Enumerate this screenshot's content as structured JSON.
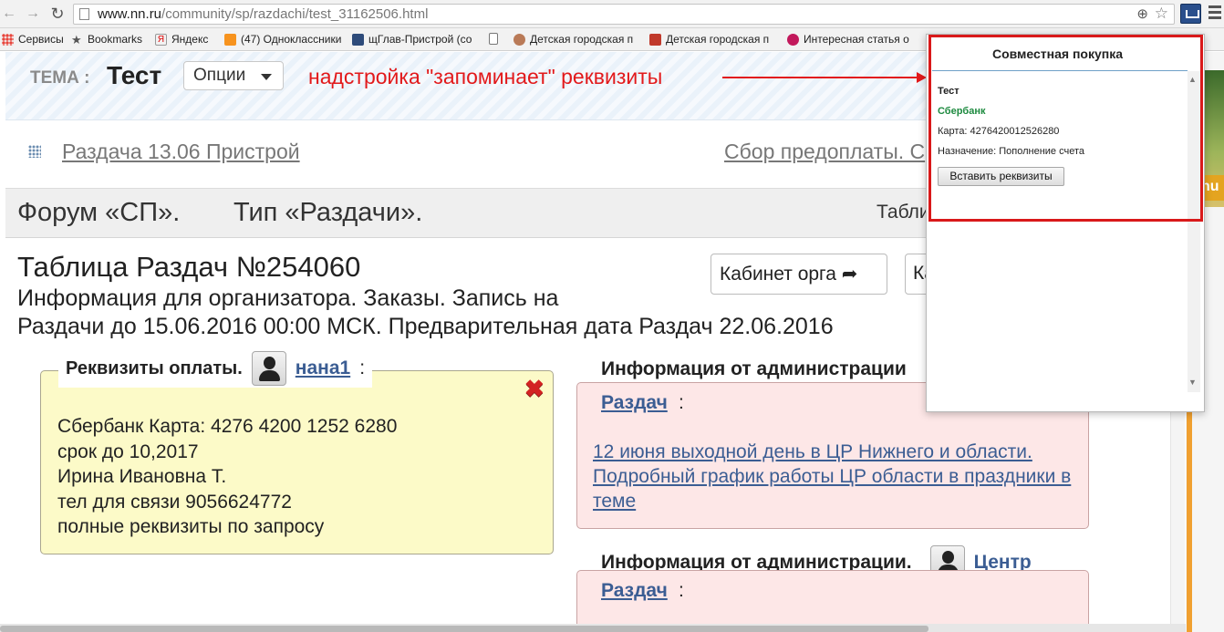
{
  "browser": {
    "url_host": "www.nn.ru",
    "url_path": "/community/sp/razdachi/test_31162506.html"
  },
  "bookmarks": [
    {
      "label": "Сервисы",
      "color": "#e8453c"
    },
    {
      "label": "Bookmarks",
      "color": "#555555"
    },
    {
      "label": "Яндекс",
      "color": "#ffffff"
    },
    {
      "label": "(47) Одноклассники",
      "color": "#f7931e"
    },
    {
      "label": "щГлав-Пристрой (со",
      "color": "#2e4b7a"
    },
    {
      "label": "",
      "color": "#ffffff"
    },
    {
      "label": "Детская городская п",
      "color": "#b97a57"
    },
    {
      "label": "Детская городская п",
      "color": "#c0392b"
    },
    {
      "label": "Интересная статья о",
      "color": "#c2185b"
    }
  ],
  "topic": {
    "label": "ТЕМА :",
    "title": "Тест",
    "options_label": "Опции",
    "annotation": "надстройка \"запоминает\" реквизиты"
  },
  "subnav": {
    "left_link": "Раздача 13.06 Пристрой",
    "right_link": "Сбор предоплаты. С"
  },
  "forum": {
    "forum": "Форум «СП».",
    "type": "Тип «Раздачи».",
    "right": "Табли"
  },
  "main": {
    "table_title": "Таблица Раздач №254060",
    "info_line1": "Информация для организатора. Заказы. Запись на",
    "info_line2": "Раздачи до 15.06.2016 00:00 МСК. Предварительная дата Раздач 22.06.2016",
    "cabinet_btn": "Кабинет орга",
    "cabinet_btn2": "Ка"
  },
  "requisites": {
    "legend": "Реквизиты оплаты.",
    "user": "нана1",
    "colon": ":",
    "lines": [
      "Сбербанк Карта: 4276 4200 1252 6280",
      "срок до 10,2017",
      "Ирина Ивановна Т.",
      "тел для связи 9056624772",
      "полные реквизиты по запросу"
    ]
  },
  "admin_info": {
    "heading": "Информация от администрации",
    "link": "Раздач",
    "colon": ":",
    "news": "12 июня выходной день в ЦР Нижнего и области. Подробный график работы ЦР области в праздники в теме",
    "heading2": "Информация от администрации.",
    "center_link": "Центр",
    "link2": "Раздач"
  },
  "right_strip": {
    "badge": "nu"
  },
  "popup": {
    "title": "Совместная покупка",
    "name": "Тест",
    "bank": "Сбербанк",
    "card": "Карта: 4276420012526280",
    "purpose": "Назначение: Пополнение счета",
    "button": "Вставить реквизиты"
  }
}
